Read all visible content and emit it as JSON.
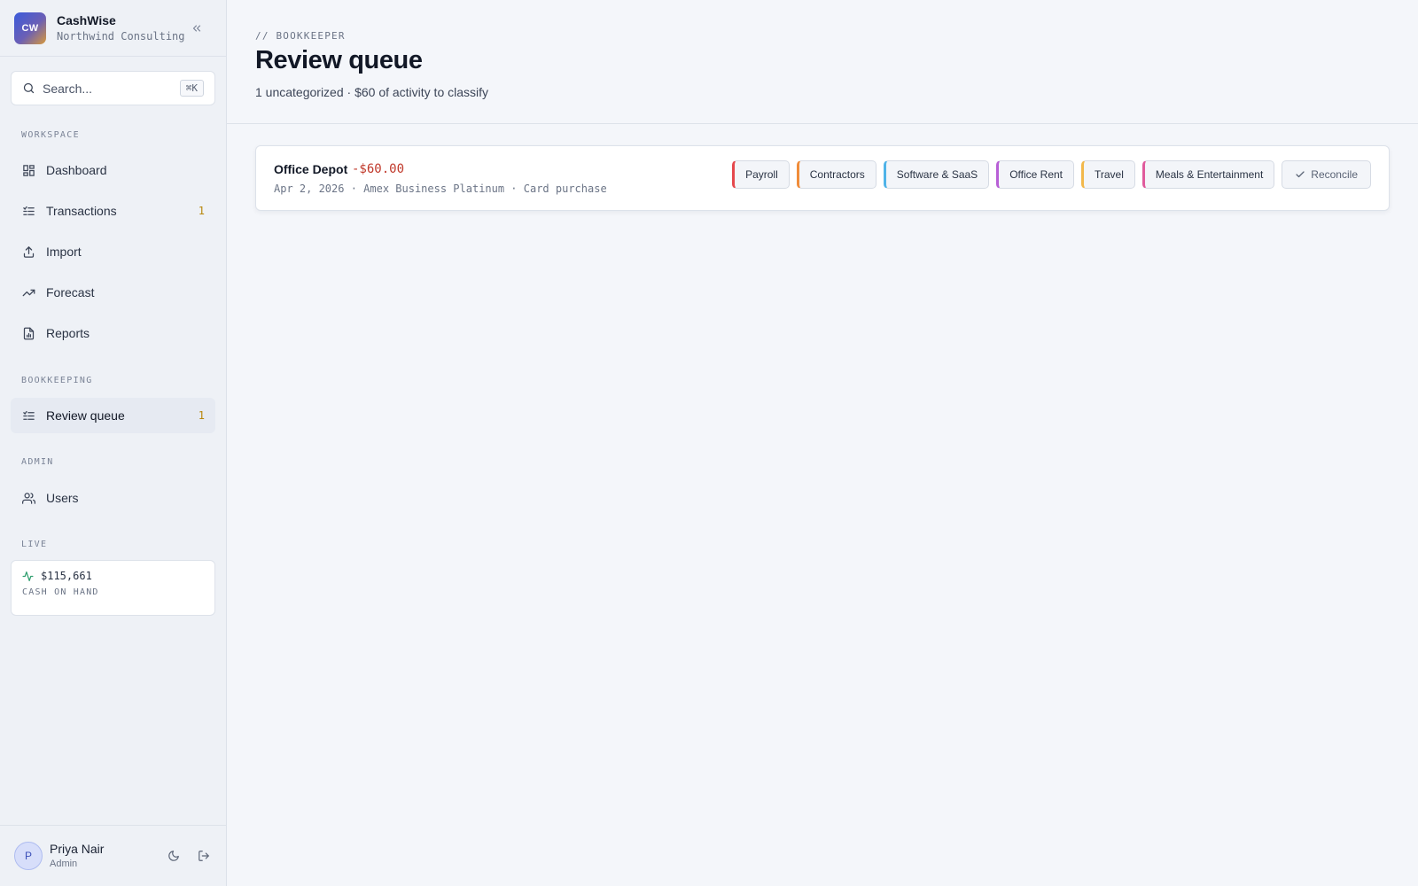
{
  "app": {
    "logo_text": "CW",
    "name": "CashWise",
    "org": "Northwind Consulting"
  },
  "search": {
    "placeholder": "Search...",
    "shortcut": "⌘K"
  },
  "sidebar": {
    "sections": {
      "workspace": "WORKSPACE",
      "bookkeeping": "BOOKKEEPING",
      "admin": "ADMIN",
      "live": "LIVE"
    },
    "items": [
      {
        "label": "Dashboard",
        "icon": "dashboard-icon"
      },
      {
        "label": "Transactions",
        "icon": "list-check-icon",
        "count": "1"
      },
      {
        "label": "Import",
        "icon": "upload-icon"
      },
      {
        "label": "Forecast",
        "icon": "trending-up-icon"
      },
      {
        "label": "Reports",
        "icon": "file-chart-icon"
      },
      {
        "label": "Review queue",
        "icon": "list-check-icon",
        "count": "1",
        "active": true
      },
      {
        "label": "Users",
        "icon": "users-icon"
      }
    ],
    "live": {
      "amount": "$115,661",
      "caption": "CASH ON HAND",
      "accent": "#2f9e6e"
    }
  },
  "user": {
    "initial": "P",
    "name": "Priya Nair",
    "role": "Admin"
  },
  "header": {
    "eyebrow": "// BOOKKEEPER",
    "title": "Review queue",
    "subtitle": "1 uncategorized · $60 of activity to classify"
  },
  "transactions": [
    {
      "merchant": "Office Depot",
      "amount": "-$60.00",
      "meta": "Apr 2, 2026 · Amex Business Platinum · Card purchase",
      "categories": [
        {
          "label": "Payroll",
          "color": "#e5484d"
        },
        {
          "label": "Contractors",
          "color": "#f08c3a"
        },
        {
          "label": "Software & SaaS",
          "color": "#4fb3e8"
        },
        {
          "label": "Office Rent",
          "color": "#b85fd6"
        },
        {
          "label": "Travel",
          "color": "#f2b84b"
        },
        {
          "label": "Meals & Entertainment",
          "color": "#e05a9c"
        }
      ],
      "reconcile_label": "Reconcile"
    }
  ],
  "colors": {
    "negative_amount": "#c0392b",
    "count_badge": "#b8860b"
  }
}
